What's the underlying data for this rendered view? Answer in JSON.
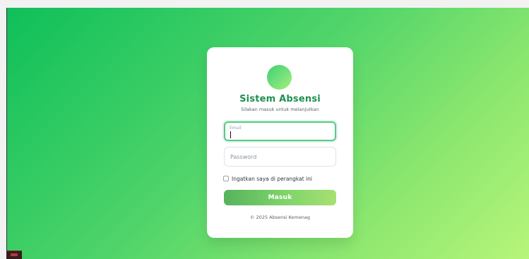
{
  "login": {
    "title": "Sistem Absensi",
    "subtitle": "Silakan masuk untuk melanjutkan",
    "email": {
      "label": "Email",
      "value": ""
    },
    "password": {
      "placeholder": "Password",
      "value": ""
    },
    "remember": {
      "label": "Ingatkan saya di perangkat ini",
      "checked": false
    },
    "submit_label": "Masuk",
    "footer": "© 2025 Absensi Kemenag"
  },
  "colors": {
    "background_start": "#0fbf5a",
    "background_end": "#b7f57a",
    "title": "#1f8f51",
    "accent": "#58c985",
    "button_start": "#57b35c",
    "button_end": "#a7e072"
  }
}
